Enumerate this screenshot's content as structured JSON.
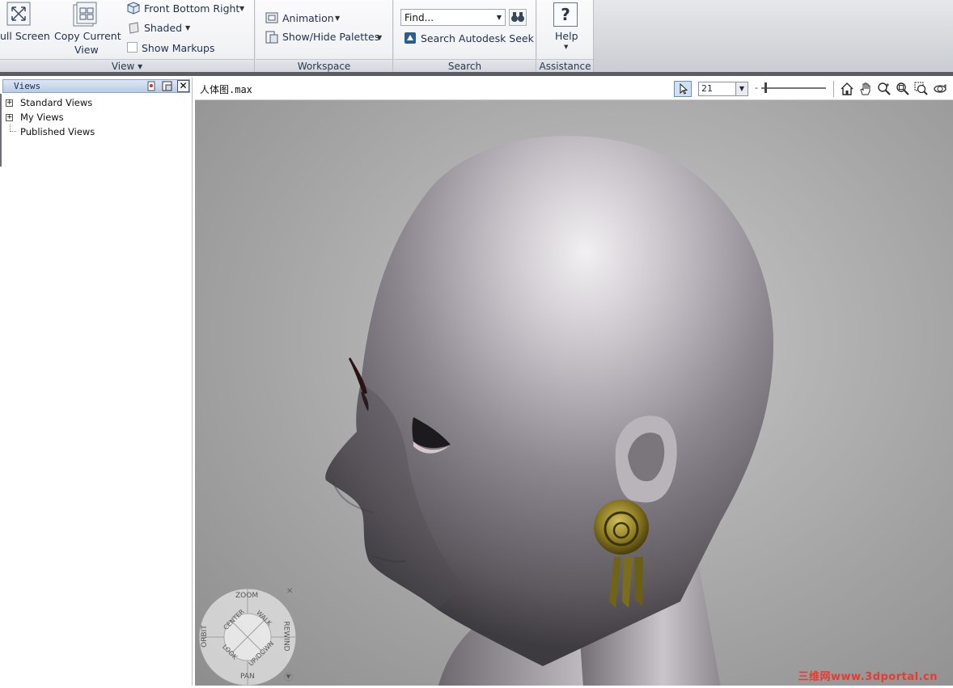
{
  "ribbon": {
    "view_group": {
      "full_screen_label": "ull Screen",
      "copy_current_view_line1": "Copy Current",
      "copy_current_view_line2": "View",
      "viewpoint_label": "Front Bottom Right",
      "render_mode_label": "Shaded",
      "show_markups_label": "Show Markups",
      "group_label": "View ▾"
    },
    "workspace_group": {
      "animation_label": "Animation",
      "palettes_label": "Show/Hide Palettes",
      "group_label": "Workspace"
    },
    "search_group": {
      "find_value": "Find...",
      "seek_label": "Search Autodesk Seek",
      "group_label": "Search"
    },
    "assistance_group": {
      "help_label": "Help",
      "group_label": "Assistance"
    }
  },
  "views_panel": {
    "title": "Views",
    "items": [
      {
        "label": "Standard Views",
        "expander": "+"
      },
      {
        "label": "My Views",
        "expander": "+"
      },
      {
        "label": "Published Views",
        "expander": ""
      }
    ]
  },
  "viewer": {
    "file_title": "人体图.max",
    "zoom_value": "21",
    "tools": [
      "select-arrow-icon",
      "home-icon",
      "pan-hand-icon",
      "zoom-icon",
      "zoom-window-icon",
      "zoom-extents-icon",
      "orbit-icon"
    ]
  },
  "steering_wheel": {
    "zoom": "ZOOM",
    "orbit": "ORBIT",
    "rewind": "REWIND",
    "pan": "PAN",
    "center": "CENTER",
    "walk": "WALK",
    "look": "LOOK",
    "updown": "UP/DOWN"
  },
  "watermark": "三维网www.3dportal.cn"
}
